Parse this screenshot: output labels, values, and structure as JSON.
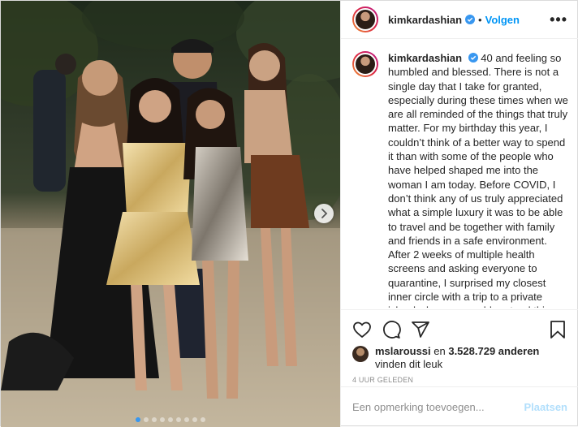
{
  "post": {
    "username": "kimkardashian",
    "verified": true,
    "follow_label": "Volgen",
    "more_icon": "more-horizontal-icon",
    "caption_text": "40 and feeling so humbled and blessed. There is not a single day that I take for granted, especially during these times when we are all reminded of the things that truly matter. For my birthday this year, I couldn’t think of a better way to spend it than with some of the people who have helped shaped me into the woman I am today. Before COVID, I don’t think any of us truly appreciated what a simple luxury it was to be able to travel and be together with family and friends in a safe environment. After 2 weeks of multiple health screens and asking everyone to quarantine, I surprised my closest inner circle with a trip to a private island where we could pretend things",
    "likes_user": "mslaroussi",
    "likes_mid": " en ",
    "likes_count": "3.528.729 anderen",
    "likes_suffix": "vinden dit leuk",
    "timestamp": "4 UUR GELEDEN",
    "comment_placeholder": "Een opmerking toevoegen...",
    "post_label": "Plaatsen",
    "carousel_total": 9,
    "carousel_active": 1
  },
  "icons": [
    "heart-icon",
    "comment-icon",
    "share-icon",
    "bookmark-icon",
    "verified-icon",
    "chevron-right-icon"
  ],
  "colors": {
    "link": "#0095f6",
    "verified": "#3897f0",
    "post_disabled": "#b2dffc",
    "muted": "#8e8e8e"
  }
}
